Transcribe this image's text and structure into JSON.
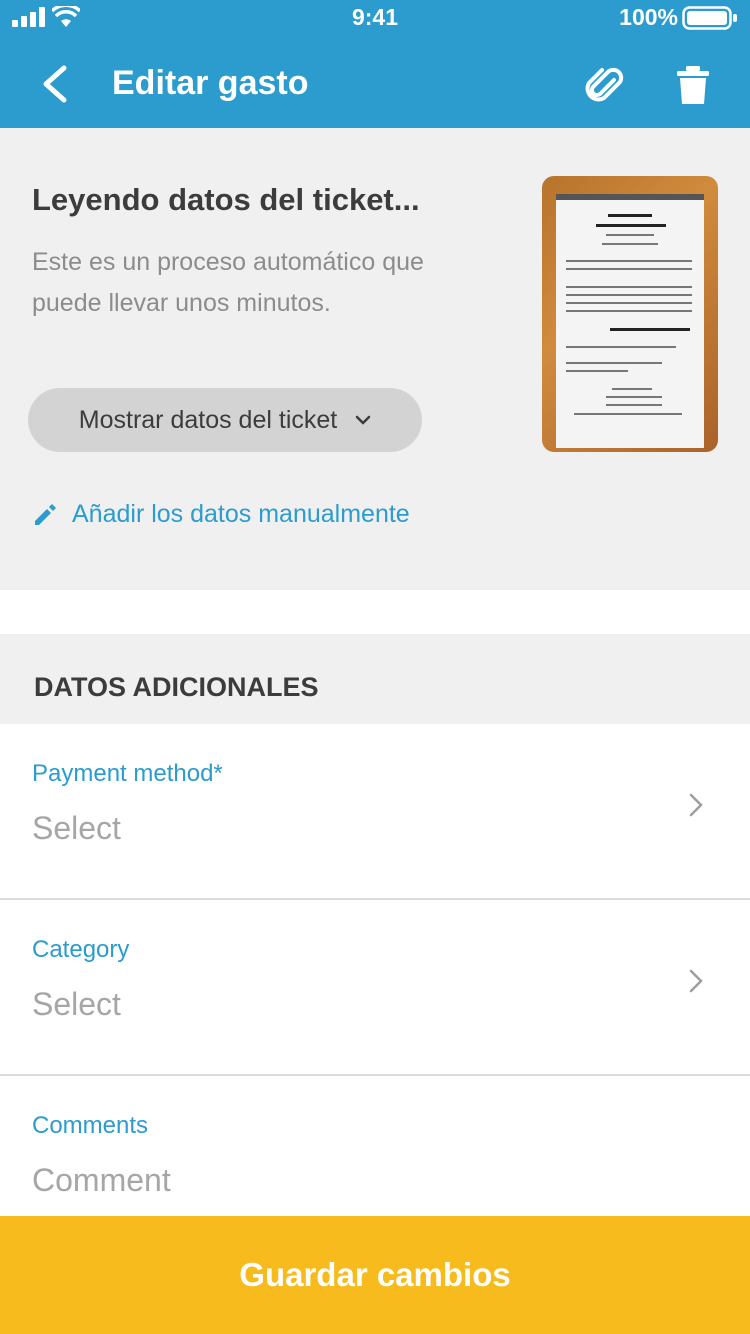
{
  "status_bar": {
    "time": "9:41",
    "battery": "100%"
  },
  "header": {
    "title": "Editar gasto"
  },
  "ticket": {
    "reading_title": "Leyendo datos del ticket...",
    "reading_description": "Este es un proceso automático que puede llevar unos minutos.",
    "show_button": "Mostrar datos del ticket",
    "manual_link": "Añadir los datos manualmente"
  },
  "additional": {
    "section_title": "DATOS ADICIONALES",
    "fields": [
      {
        "label": "Payment method*",
        "placeholder": "Select"
      },
      {
        "label": "Category",
        "placeholder": "Select"
      },
      {
        "label": "Comments",
        "placeholder": "Comment"
      }
    ]
  },
  "footer": {
    "save_label": "Guardar cambios"
  },
  "colors": {
    "primary": "#2b9ccd",
    "accent": "#f7bb1d"
  },
  "icons": [
    "back-icon",
    "attach-icon",
    "trash-icon",
    "chevron-down-icon",
    "pencil-icon",
    "chevron-right-icon",
    "signal-icon",
    "wifi-icon",
    "battery-icon"
  ]
}
